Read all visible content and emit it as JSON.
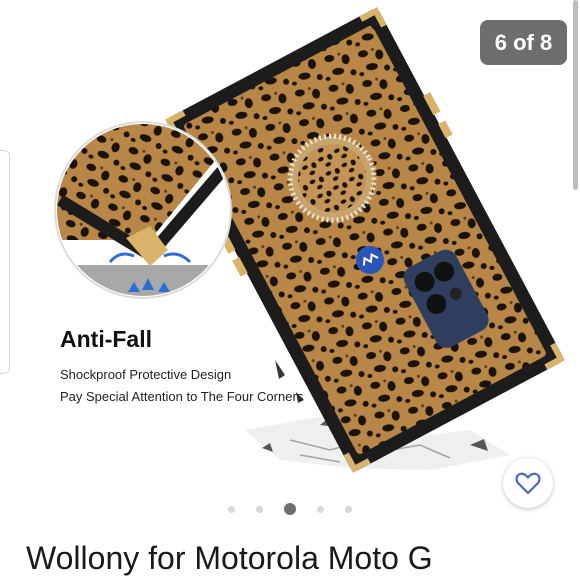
{
  "gallery": {
    "counter": "6 of 8",
    "image_count": 8,
    "active_index": 3
  },
  "feature": {
    "title": "Anti-Fall",
    "line1": "Shockproof Protective Design",
    "line2": "Pay Special Attention to The Four Corners"
  },
  "product": {
    "title": "Wollony for Motorola Moto G"
  },
  "icons": {
    "favorite": "heart-outline-icon"
  },
  "colors": {
    "counter_bg": "#6e6e6e",
    "heart_accent": "#4a69b5"
  }
}
